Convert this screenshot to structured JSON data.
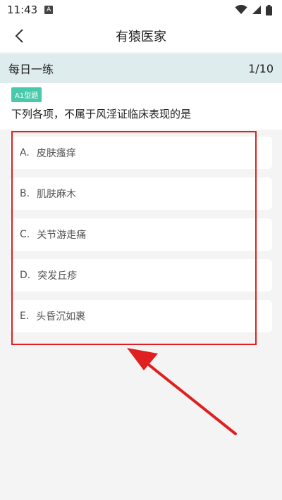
{
  "status_bar": {
    "time": "11:43",
    "notif_letter": "A"
  },
  "nav": {
    "title": "有猿医家"
  },
  "section": {
    "title": "每日一练",
    "progress": "1/10"
  },
  "question": {
    "type_badge": "A1型题",
    "text": "下列各项，不属于风淫证临床表现的是"
  },
  "options": [
    {
      "letter": "A.",
      "text": "皮肤瘙痒"
    },
    {
      "letter": "B.",
      "text": "肌肤麻木"
    },
    {
      "letter": "C.",
      "text": "关节游走痛"
    },
    {
      "letter": "D.",
      "text": "突发丘疹"
    },
    {
      "letter": "E.",
      "text": "头昏沉如裹"
    }
  ],
  "colors": {
    "accent": "#48c9a9",
    "header_bg": "#deecee",
    "annotation": "#e02020"
  },
  "icons": [
    "back-arrow-icon",
    "wifi-icon",
    "signal-icon",
    "battery-icon"
  ]
}
